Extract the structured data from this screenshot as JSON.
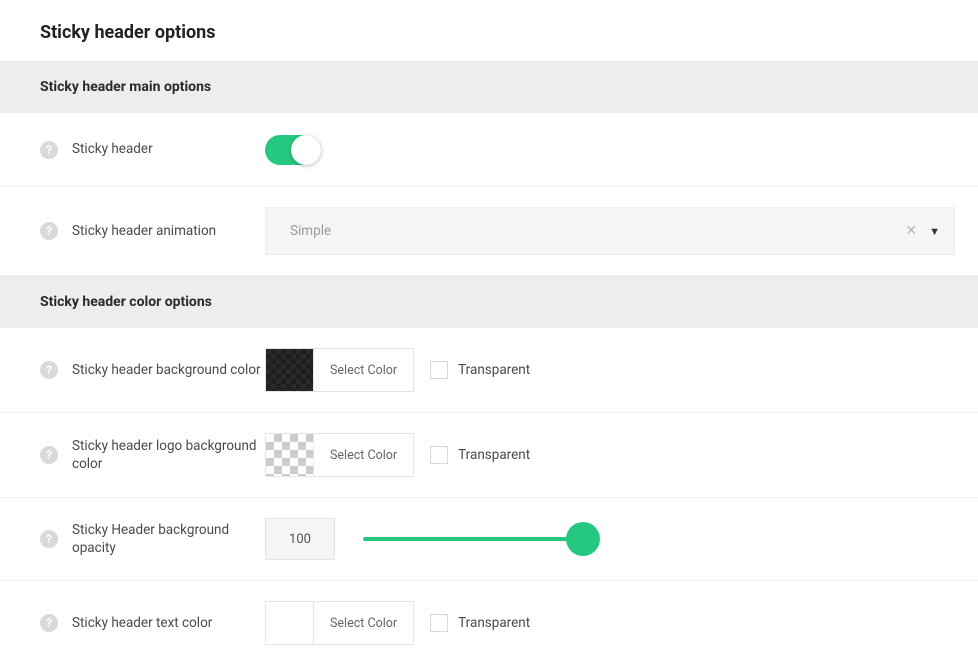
{
  "page": {
    "title": "Sticky header options"
  },
  "sections": {
    "main": {
      "title": "Sticky header main options"
    },
    "color": {
      "title": "Sticky header color options"
    }
  },
  "rows": {
    "sticky_header": {
      "label": "Sticky header",
      "on": true
    },
    "animation": {
      "label": "Sticky header animation",
      "value": "Simple"
    },
    "bg_color": {
      "label": "Sticky header background color",
      "select_label": "Select Color",
      "transparent_label": "Transparent"
    },
    "logo_bg_color": {
      "label": "Sticky header logo background color",
      "select_label": "Select Color",
      "transparent_label": "Transparent"
    },
    "bg_opacity": {
      "label": "Sticky Header background opacity",
      "value": "100"
    },
    "text_color": {
      "label": "Sticky header text color",
      "select_label": "Select Color",
      "transparent_label": "Transparent"
    }
  },
  "colors": {
    "accent": "#26c87f"
  }
}
